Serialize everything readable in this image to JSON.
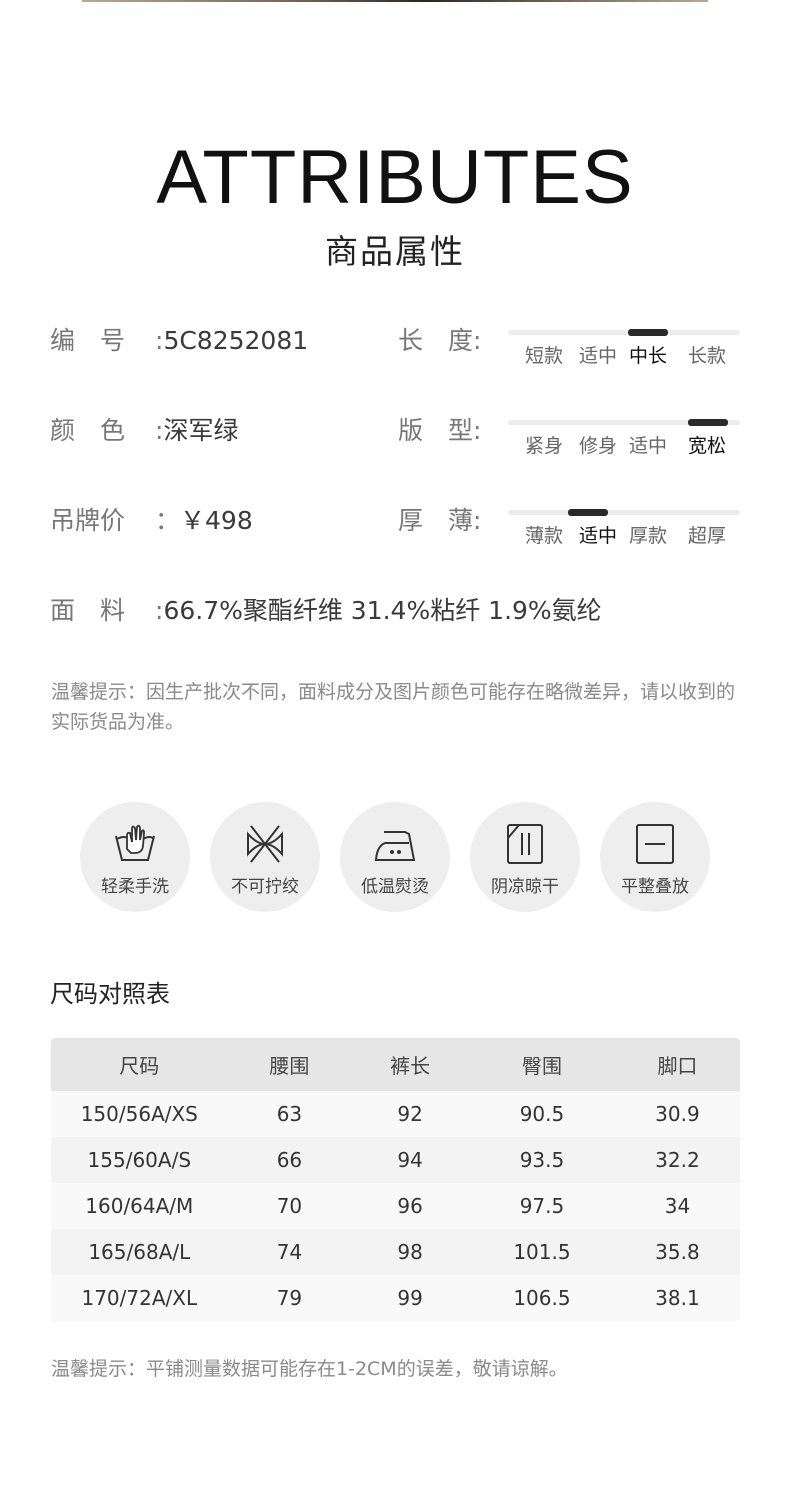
{
  "hero": {
    "title_en": "ATTRIBUTES",
    "title_cn": "商品属性"
  },
  "attributes": {
    "code": {
      "key": "编　号",
      "colon": ":",
      "value": "5C8252081"
    },
    "color": {
      "key": "颜　色",
      "colon": ":",
      "value": "深军绿"
    },
    "price": {
      "key": "吊牌价",
      "colon": "：",
      "value": "￥498"
    },
    "fabric": {
      "key": "面　料",
      "colon": ":",
      "value": "66.7%聚酯纤维 31.4%粘纤 1.9%氨纶"
    }
  },
  "scales": [
    {
      "label": "长　度:",
      "options": [
        "短款",
        "适中",
        "中长",
        "长款"
      ],
      "selected_index": 2
    },
    {
      "label": "版　型:",
      "options": [
        "紧身",
        "修身",
        "适中",
        "宽松"
      ],
      "selected_index": 3
    },
    {
      "label": "厚　薄:",
      "options": [
        "薄款",
        "适中",
        "厚款",
        "超厚"
      ],
      "selected_index": 1
    }
  ],
  "tip1": "温馨提示：因生产批次不同，面料成分及图片颜色可能存在略微差异，请以收到的实际货品为准。",
  "care": [
    {
      "icon": "hand-wash-icon",
      "label": "轻柔手洗"
    },
    {
      "icon": "no-wring-icon",
      "label": "不可拧绞"
    },
    {
      "icon": "low-iron-icon",
      "label": "低温熨烫"
    },
    {
      "icon": "shade-dry-icon",
      "label": "阴凉晾干"
    },
    {
      "icon": "flat-dry-icon",
      "label": "平整叠放"
    }
  ],
  "size_chart": {
    "title": "尺码对照表",
    "headers": [
      "尺码",
      "腰围",
      "裤长",
      "臀围",
      "脚口"
    ],
    "rows": [
      [
        "150/56A/XS",
        "63",
        "92",
        "90.5",
        "30.9"
      ],
      [
        "155/60A/S",
        "66",
        "94",
        "93.5",
        "32.2"
      ],
      [
        "160/64A/M",
        "70",
        "96",
        "97.5",
        "34"
      ],
      [
        "165/68A/L",
        "74",
        "98",
        "101.5",
        "35.8"
      ],
      [
        "170/72A/XL",
        "79",
        "99",
        "106.5",
        "38.1"
      ]
    ]
  },
  "tip2": "温馨提示：平铺测量数据可能存在1-2CM的误差，敬请谅解。"
}
